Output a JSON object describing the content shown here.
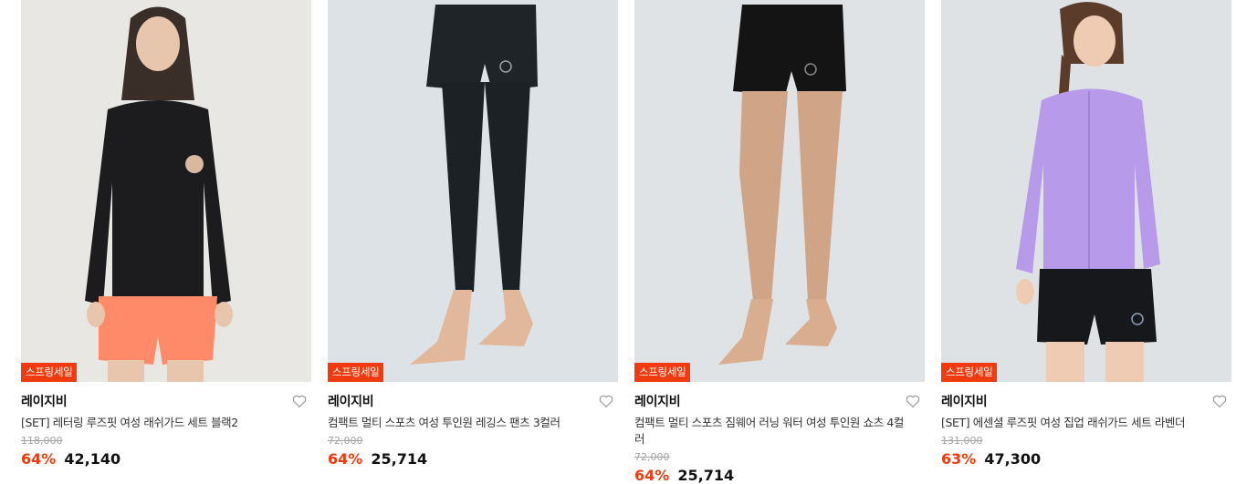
{
  "products": [
    {
      "badge": "스프링세일",
      "brand": "레이지비",
      "title": "[SET] 레터링 루즈핏 여성 래쉬가드 세트 블랙2",
      "original_price": "118,000",
      "discount": "64%",
      "price": "42,140",
      "image_bg": "#e9e7e4"
    },
    {
      "badge": "스프링세일",
      "brand": "레이지비",
      "title": "컴팩트 멀티 스포츠 여성 투인원 레깅스 팬츠 3컬러",
      "original_price": "72,000",
      "discount": "64%",
      "price": "25,714",
      "image_bg": "#dde2e6"
    },
    {
      "badge": "스프링세일",
      "brand": "레이지비",
      "title": "컴팩트 멀티 스포츠 짐웨어 러닝 워터 여성 투인원 쇼츠 4컬러",
      "original_price": "72,000",
      "discount": "64%",
      "price": "25,714",
      "image_bg": "#dfe3e6"
    },
    {
      "badge": "스프링세일",
      "brand": "레이지비",
      "title": "[SET] 에센셜 루즈핏 여성 집업 래쉬가드 세트 라벤더",
      "original_price": "131,000",
      "discount": "63%",
      "price": "47,300",
      "image_bg": "#dfe2e5"
    }
  ],
  "colors": {
    "accent": "#ef3b0f",
    "text": "#111111",
    "muted": "#a3a3a3"
  },
  "icons": [
    "heart-outline-icon"
  ]
}
